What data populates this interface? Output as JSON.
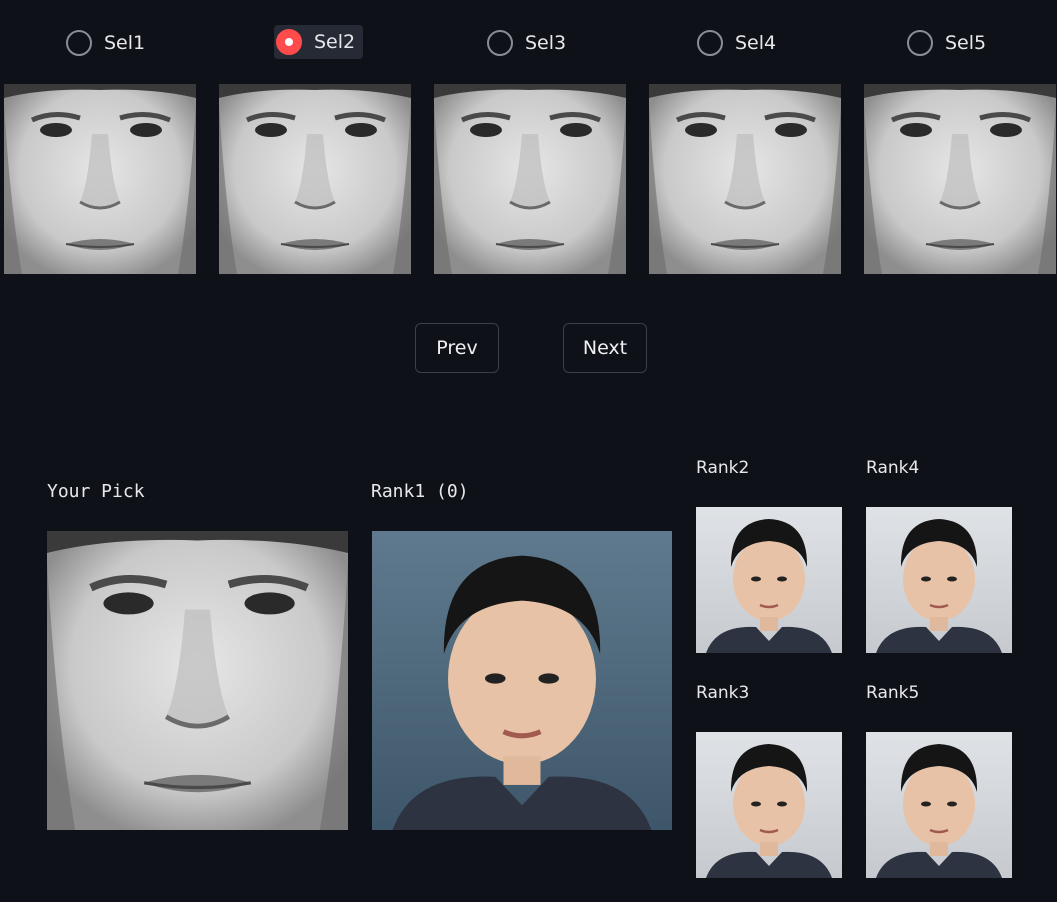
{
  "selections": [
    {
      "label": "Sel1",
      "selected": false
    },
    {
      "label": "Sel2",
      "selected": true
    },
    {
      "label": "Sel3",
      "selected": false
    },
    {
      "label": "Sel4",
      "selected": false
    },
    {
      "label": "Sel5",
      "selected": false
    }
  ],
  "navigation": {
    "prev_label": "Prev",
    "next_label": "Next"
  },
  "results": {
    "your_pick_label": "Your Pick",
    "rank1_label": "Rank1 (0)",
    "rank2_label": "Rank2",
    "rank3_label": "Rank3",
    "rank4_label": "Rank4",
    "rank5_label": "Rank5"
  },
  "colors": {
    "background": "#0f1118",
    "accent": "#ff4b4b",
    "button_border": "#3b3f4b"
  }
}
